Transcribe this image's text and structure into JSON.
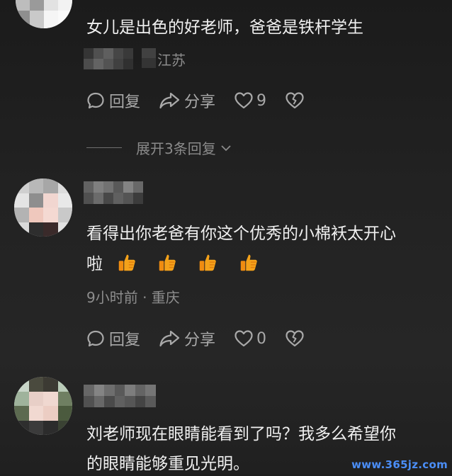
{
  "comments": [
    {
      "text": "女儿是出色的好老师，爸爸是铁杆学生",
      "location": "江苏",
      "reply_label": "回复",
      "share_label": "分享",
      "like_count": "9"
    },
    {
      "text_line1": "看得出你老爸有你这个优秀的小棉袄太开心",
      "text_line2": "啦",
      "emojis": [
        "thumbs-up",
        "thumbs-up",
        "thumbs-up",
        "thumbs-up"
      ],
      "meta": "9小时前 · 重庆",
      "reply_label": "回复",
      "share_label": "分享",
      "like_count": "0"
    },
    {
      "text_line1": "刘老师现在眼睛能看到了吗？我多么希望你",
      "text_line2": "的眼睛能够重见光明。"
    }
  ],
  "expand_replies": {
    "label": "展开3条回复"
  },
  "watermark": "www.365jz.com",
  "colors": {
    "background": "#222222",
    "text_primary": "#f0f0f0",
    "text_secondary": "#8d8d8d",
    "icon": "#a9a9a9",
    "emoji": "#f4a21a"
  }
}
